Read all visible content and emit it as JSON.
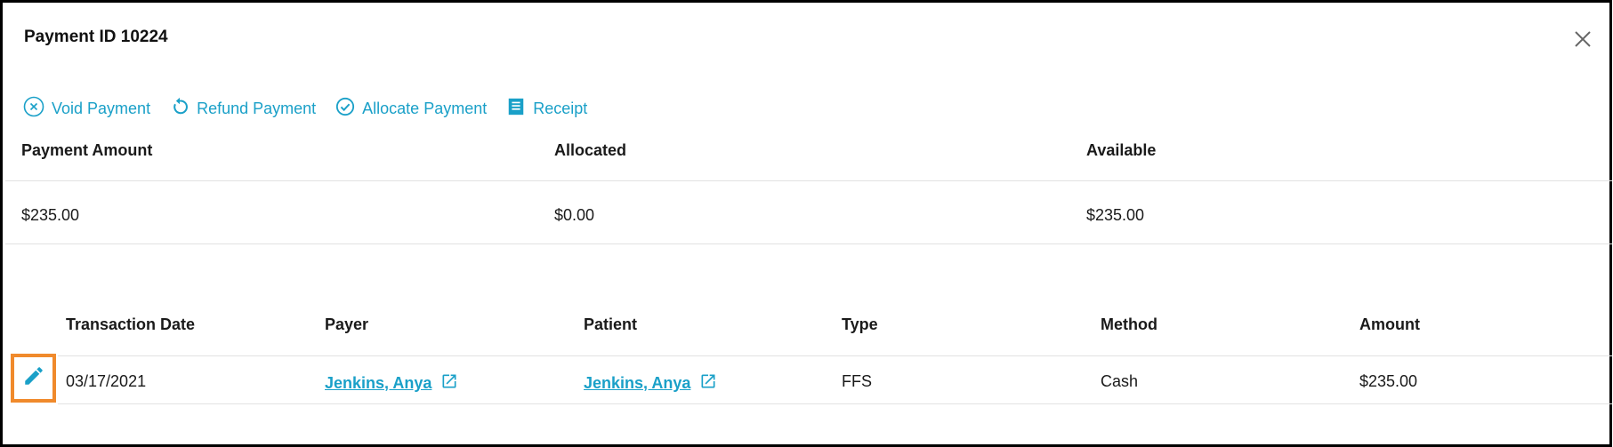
{
  "modal": {
    "title": "Payment ID 10224"
  },
  "actions": [
    {
      "label": "Void Payment",
      "icon": "void-circle-x-icon"
    },
    {
      "label": "Refund Payment",
      "icon": "refund-arrow-icon"
    },
    {
      "label": "Allocate Payment",
      "icon": "allocate-check-icon"
    },
    {
      "label": "Receipt",
      "icon": "receipt-icon"
    }
  ],
  "summary": {
    "headers": [
      "Payment Amount",
      "Allocated",
      "Available"
    ],
    "values": [
      "$235.00",
      "$0.00",
      "$235.00"
    ]
  },
  "transactions": {
    "headers": [
      "Transaction Date",
      "Payer",
      "Patient",
      "Type",
      "Method",
      "Amount"
    ],
    "rows": [
      {
        "date": "03/17/2021",
        "payer": "Jenkins, Anya",
        "patient": "Jenkins, Anya",
        "type": "FFS",
        "method": "Cash",
        "amount": "$235.00"
      }
    ]
  },
  "colors": {
    "accent": "#1aa0c8",
    "highlight": "#f08a2c"
  }
}
